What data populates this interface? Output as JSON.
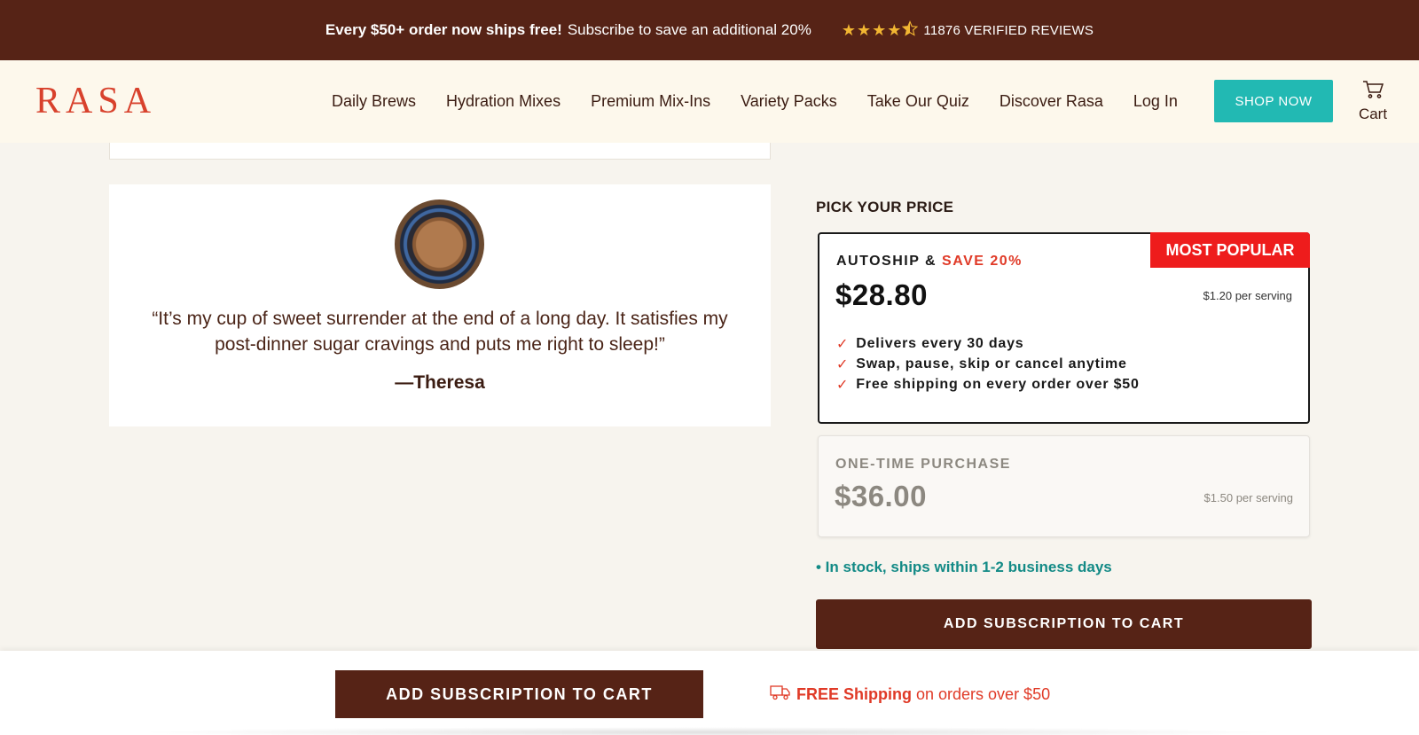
{
  "announcement": {
    "bold": "Every $50+ order now ships free!",
    "text": "Subscribe to save an additional 20%",
    "rating": 4.5,
    "reviews": "11876 VERIFIED REVIEWS"
  },
  "nav": {
    "logo": "RASA",
    "links": [
      "Daily Brews",
      "Hydration Mixes",
      "Premium Mix-Ins",
      "Variety Packs",
      "Take Our Quiz",
      "Discover Rasa",
      "Log In"
    ],
    "shop_now": "SHOP NOW",
    "cart": "Cart"
  },
  "testimonial": {
    "quote": "“It’s my cup of sweet surrender at the end of a long day. It satisfies my post-dinner sugar cravings and puts me right to sleep!”",
    "author": "—Theresa"
  },
  "pricing": {
    "title": "PICK YOUR PRICE",
    "autoship": {
      "label": "AUTOSHIP &",
      "save": "SAVE 20%",
      "badge": "MOST POPULAR",
      "price": "$28.80",
      "per_serving": "$1.20 per serving",
      "features": [
        "Delivers every 30 days",
        "Swap, pause, skip or cancel anytime",
        "Free shipping on every order over $50"
      ]
    },
    "onetime": {
      "label": "ONE-TIME PURCHASE",
      "price": "$36.00",
      "per_serving": "$1.50 per serving"
    },
    "stock": "• In stock, ships within 1-2 business days",
    "add_button": "ADD SUBSCRIPTION TO CART"
  },
  "sticky": {
    "add_button": "ADD SUBSCRIPTION TO CART",
    "free": "FREE Shipping",
    "rest": "on orders over $50"
  },
  "colors": {
    "brand_dark": "#562316",
    "accent_teal": "#22b9b3",
    "accent_red": "#e03a27"
  }
}
